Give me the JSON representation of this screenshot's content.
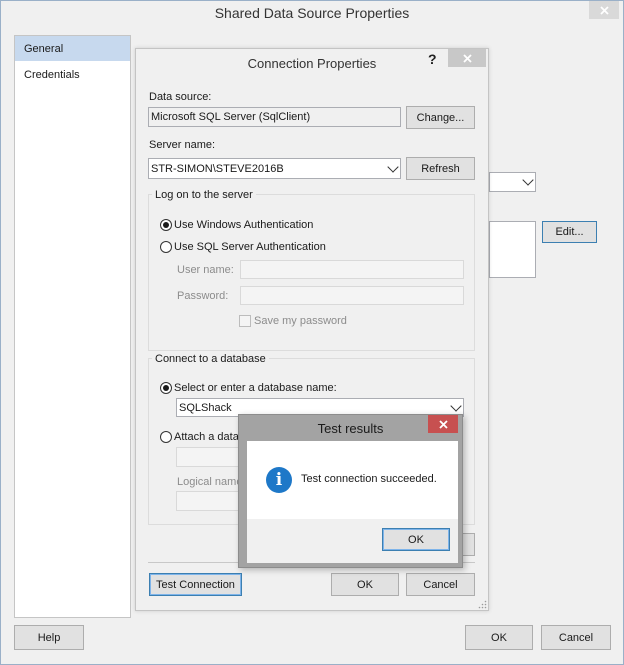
{
  "main_window": {
    "title": "Shared Data Source Properties",
    "nav_items": [
      {
        "label": "General",
        "selected": true
      },
      {
        "label": "Credentials",
        "selected": false
      }
    ],
    "edit_label": "Edit...",
    "help_label": "Help",
    "ok_label": "OK",
    "cancel_label": "Cancel"
  },
  "connection_dialog": {
    "title": "Connection Properties",
    "help_glyph": "?",
    "data_source_label": "Data source:",
    "data_source_value": "Microsoft SQL Server (SqlClient)",
    "change_label": "Change...",
    "server_name_label": "Server name:",
    "server_name_value": "STR-SIMON\\STEVE2016B",
    "refresh_label": "Refresh",
    "logon_group_label": "Log on to the server",
    "windows_auth_label": "Use Windows Authentication",
    "sql_auth_label": "Use SQL Server Authentication",
    "user_name_label": "User name:",
    "password_label": "Password:",
    "save_password_label": "Save my password",
    "db_group_label": "Connect to a database",
    "select_db_label": "Select or enter a database name:",
    "db_value": "SQLShack",
    "attach_db_label": "Attach a datab",
    "logical_name_label": "Logical name",
    "test_connection_label": "Test Connection",
    "ok_label": "OK",
    "cancel_label": "Cancel"
  },
  "test_results": {
    "title": "Test results",
    "message": "Test connection succeeded.",
    "ok_label": "OK",
    "info_glyph": "i"
  },
  "colors": {
    "close_red": "#c75050",
    "info_blue": "#1e78c8",
    "nav_selected": "#c7d9ee"
  }
}
